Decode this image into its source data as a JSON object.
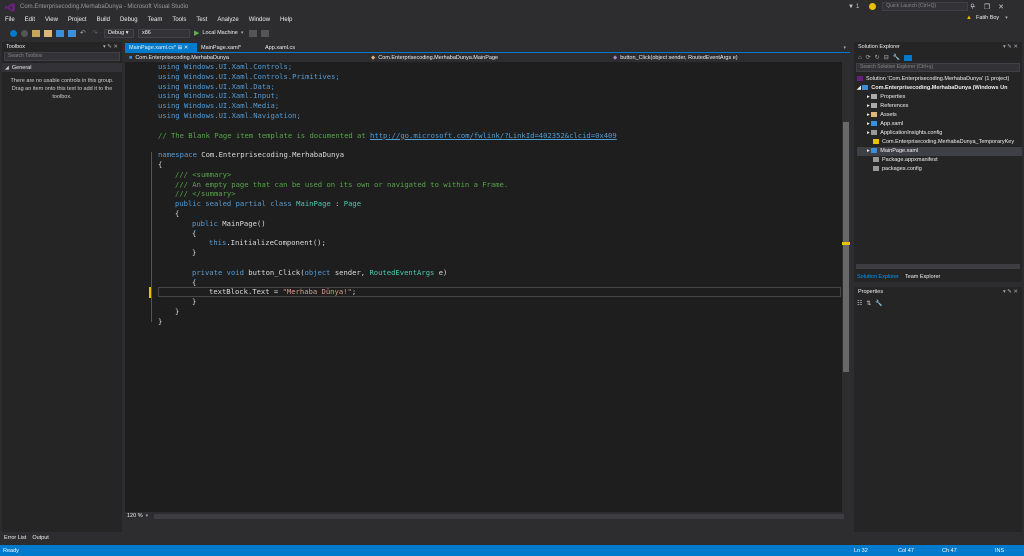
{
  "window": {
    "title": "Com.Enterprisecoding.MerhabaDunya - Microsoft Visual Studio",
    "notifications": "1",
    "quick_launch_placeholder": "Quick Launch (Ctrl+Q)",
    "user": "Fatih Boy"
  },
  "menu": [
    "File",
    "Edit",
    "View",
    "Project",
    "Build",
    "Debug",
    "Team",
    "Tools",
    "Test",
    "Analyze",
    "Window",
    "Help"
  ],
  "toolbar": {
    "config": "Debug",
    "platform": "x86",
    "run_label": "Local Machine"
  },
  "toolbox": {
    "title": "Toolbox",
    "search_placeholder": "Search Toolbox",
    "group": "General",
    "empty_message": "There are no usable controls in this group. Drag an item onto this text to add it to the toolbox."
  },
  "tabs": [
    {
      "label": "MainPage.xaml.cs*",
      "active": true
    },
    {
      "label": "MainPage.xaml*",
      "active": false
    },
    {
      "label": "App.xaml.cs",
      "active": false
    }
  ],
  "nav": {
    "project": "Com.Enterprisecoding.MerhabaDunya",
    "class": "Com.Enterprisecoding.MerhabaDunya.MainPage",
    "member": "button_Click(object sender, RoutedEventArgs e)"
  },
  "code_lines": {
    "l1": "using Windows.UI.Xaml.Controls;",
    "l2": "using Windows.UI.Xaml.Controls.Primitives;",
    "l3": "using Windows.UI.Xaml.Data;",
    "l4": "using Windows.UI.Xaml.Input;",
    "l5": "using Windows.UI.Xaml.Media;",
    "l6": "using Windows.UI.Xaml.Navigation;",
    "comment_prefix": "// The Blank Page item template is documented at ",
    "comment_link": "http://go.microsoft.com/fwlink/?LinkId=402352&clcid=0x409",
    "ns_kw": "namespace",
    "ns_name": " Com.Enterprisecoding.MerhabaDunya",
    "summary_open": "/// <summary>",
    "summary_text": "/// An empty page that can be used on its own or navigated to within a Frame.",
    "summary_close": "/// </summary>",
    "class_decl_kw": "public sealed partial class ",
    "class_name": "MainPage",
    "class_sep": " : ",
    "class_base": "Page",
    "ctor_kw": "public ",
    "ctor_name": "MainPage()",
    "this_kw": "this",
    "init_call": ".InitializeComponent();",
    "method_kw": "private void ",
    "method_name": "button_Click(",
    "method_param1_kw": "object",
    "method_param1": " sender, ",
    "method_param2_ty": "RoutedEventArgs",
    "method_param2": " e)",
    "assign": "textBlock.Text = ",
    "assign_str": "\"Merhaba Dünya!\"",
    "assign_end": ";",
    "ob": "{",
    "cb": "}"
  },
  "zoom": "120 %",
  "solution_explorer": {
    "title": "Solution Explorer",
    "search_placeholder": "Search Solution Explorer (Ctrl+ş)",
    "solution": "Solution 'Com.Enterprisecoding.MerhabaDunya' (1 project)",
    "project": "Com.Enterprisecoding.MerhabaDunya (Windows Un",
    "items": [
      "Properties",
      "References",
      "Assets",
      "App.xaml",
      "ApplicationInsights.config",
      "Com.Enterprisecoding.MerhabaDunya_TemporaryKey",
      "MainPage.xaml",
      "Package.appxmanifest",
      "packages.config"
    ],
    "tab1": "Solution Explorer",
    "tab2": "Team Explorer"
  },
  "properties": {
    "title": "Properties"
  },
  "bottom_tabs": [
    "Error List",
    "Output"
  ],
  "status": {
    "left": "Ready",
    "ln": "Ln 32",
    "col": "Col 47",
    "ch": "Ch 47",
    "mode": "INS"
  },
  "colors": {
    "accent": "#007acc",
    "editor_bg": "#1e1e1e",
    "chrome": "#2d2d30"
  }
}
